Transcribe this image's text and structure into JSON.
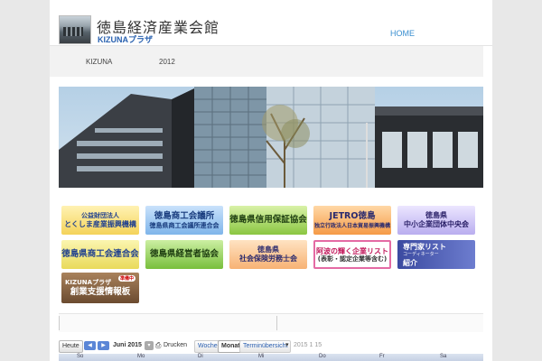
{
  "header": {
    "title": "徳島経済産業会館",
    "subtitle": "KIZUNAプラザ",
    "nav_home": "HOME"
  },
  "subnav": {
    "item1": "KIZUNA",
    "item2": "2012"
  },
  "banners": {
    "b1_l1": "公益財団法人",
    "b1_l2": "とくしま産業振興機構",
    "b2_l1": "徳島商工会議所",
    "b2_l2": "徳島県商工会議所連合会",
    "b3": "徳島県信用保証協会",
    "b4_l1": "JETRO徳島",
    "b4_l2": "独立行政法人日本貿易振興機構",
    "b5_l1": "徳島県",
    "b5_l2": "中小企業団体中央会",
    "b6": "徳島県商工会連合会",
    "b7": "徳島県経営者協会",
    "b8_l1": "徳島県",
    "b8_l2": "社会保険労務士会",
    "b9_l1": "阿波の輝く企業リスト",
    "b9_l2": "(表彰・認定企業等含む)",
    "b10_l1": "専門家リスト",
    "b10_l2": "コーディネーター",
    "b10_l3": "紹介",
    "b11_l1": "KIZUNAプラザ",
    "b11_l2": "創業支援情報板",
    "b11_badge": "準備中"
  },
  "calendar": {
    "today": "Heute",
    "prev": "◀",
    "next": "▶",
    "month": "Juni 2015",
    "print": "Drucken",
    "week": "Woche",
    "month_view": "Monat",
    "agenda": "Terminübersicht",
    "date_hint": "2015 1 15",
    "days": [
      "So",
      "Mo",
      "Di",
      "Mi",
      "Do",
      "Fr",
      "Sa"
    ]
  }
}
